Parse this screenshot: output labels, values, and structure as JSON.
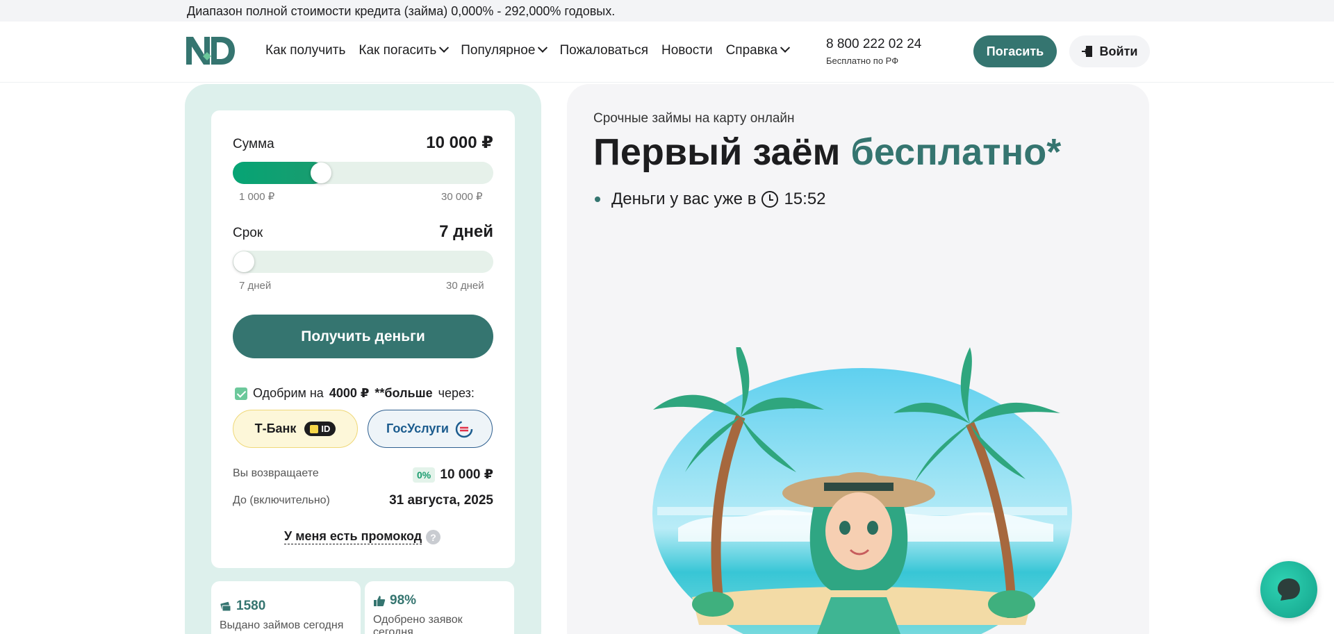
{
  "topbar": {
    "text": "Диапазон полной стоимости кредита (займа) 0,000% - 292,000% годовых."
  },
  "header": {
    "logo_alt": "ND",
    "nav": [
      {
        "label": "Как получить",
        "has_dropdown": false
      },
      {
        "label": "Как погасить",
        "has_dropdown": true
      },
      {
        "label": "Популярное",
        "has_dropdown": true
      },
      {
        "label": "Пожаловаться",
        "has_dropdown": false
      },
      {
        "label": "Новости",
        "has_dropdown": false
      },
      {
        "label": "Справка",
        "has_dropdown": true
      }
    ],
    "phone": "8 800 222 02 24",
    "phone_sub": "Бесплатно по РФ",
    "pay_label": "Погасить",
    "login_label": "Войти"
  },
  "calculator": {
    "sum_label": "Сумма",
    "sum_value": "10 000 ₽",
    "sum_min": "1 000 ₽",
    "sum_max": "30 000 ₽",
    "sum_fraction": 0.31,
    "term_label": "Срок",
    "term_value": "7 дней",
    "term_min": "7 дней",
    "term_max": "30 дней",
    "term_fraction": 0.0,
    "get_money_label": "Получить деньги",
    "approve_prefix": "Одобрим на",
    "approve_amount": "4000 ₽",
    "approve_more": "**больше",
    "approve_suffix": "через:",
    "tbank_label": "Т-Банк",
    "tbank_badge": "ID",
    "gos_label": "ГосУслуги",
    "return_label": "Вы возвращаете",
    "return_pct": "0%",
    "return_value": "10 000 ₽",
    "until_label": "До (включительно)",
    "until_value": "31 августа, 2025",
    "promo_label": "У меня есть промокод",
    "promo_help": "?"
  },
  "stats": [
    {
      "value": "1580",
      "label": "Выдано займов сегодня",
      "icon": "money-icon"
    },
    {
      "value": "98%",
      "label": "Одобрено заявок сегодня",
      "icon": "thumbs-up-icon"
    }
  ],
  "hero": {
    "subtitle": "Срочные займы на карту онлайн",
    "title_main": "Первый заём",
    "title_accent": "бесплатно*",
    "bullet_text": "Деньги у вас уже в",
    "bullet_time": "15:52"
  },
  "colors": {
    "brand": "#357570",
    "accent_green": "#1a9c6f",
    "calc_bg": "#ddf0ec",
    "hero_bg": "#f5f5f7"
  }
}
